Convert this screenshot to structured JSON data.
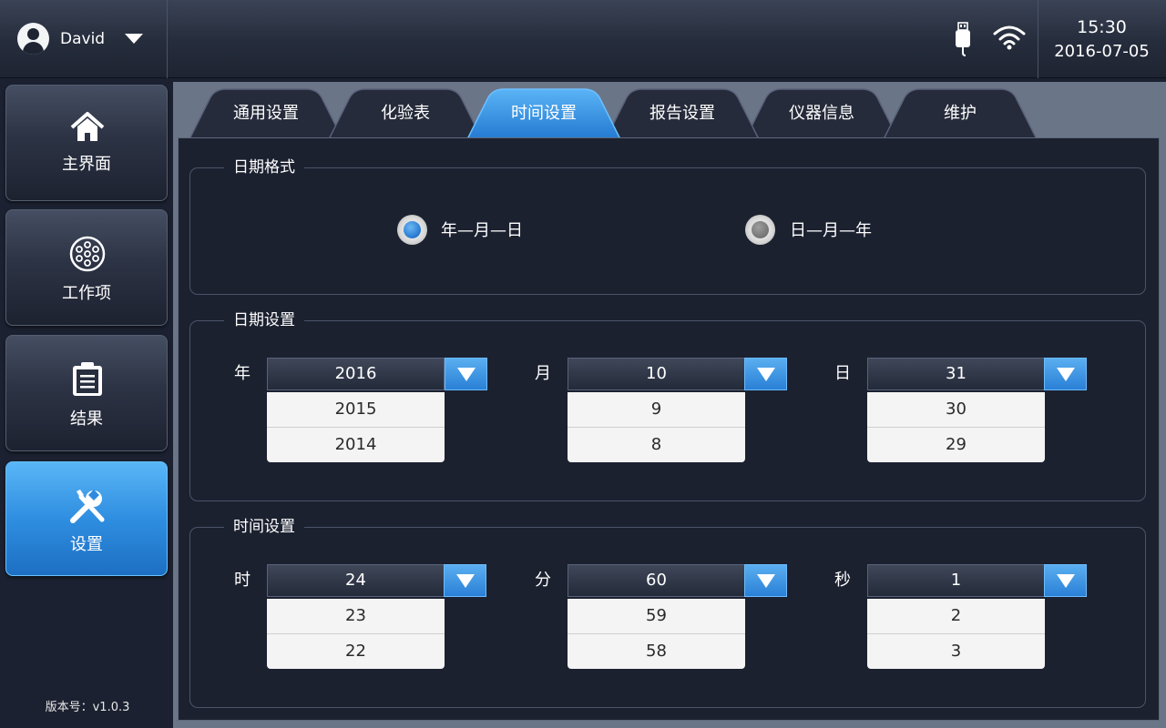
{
  "header": {
    "username": "David",
    "time": "15:30",
    "date": "2016-07-05",
    "icons": [
      "user-avatar-icon",
      "chevron-down-icon",
      "usb-icon",
      "wifi-icon"
    ]
  },
  "sidebar": {
    "items": [
      {
        "label": "主界面",
        "icon": "home-icon"
      },
      {
        "label": "工作项",
        "icon": "sample-tray-icon"
      },
      {
        "label": "结果",
        "icon": "clipboard-icon"
      },
      {
        "label": "设置",
        "icon": "tools-icon",
        "active": true
      }
    ],
    "version": "版本号：v1.0.3"
  },
  "tabs": [
    {
      "label": "通用设置"
    },
    {
      "label": "化验表"
    },
    {
      "label": "时间设置",
      "active": true
    },
    {
      "label": "报告设置"
    },
    {
      "label": "仪器信息"
    },
    {
      "label": "维护"
    }
  ],
  "date_format": {
    "title": "日期格式",
    "options": [
      {
        "label": "年—月—日",
        "selected": true
      },
      {
        "label": "日—月—年",
        "selected": false
      }
    ]
  },
  "date_settings": {
    "title": "日期设置",
    "fields": [
      {
        "label": "年",
        "value": "2016",
        "options": [
          "2015",
          "2014"
        ]
      },
      {
        "label": "月",
        "value": "10",
        "options": [
          "9",
          "8"
        ]
      },
      {
        "label": "日",
        "value": "31",
        "options": [
          "30",
          "29"
        ]
      }
    ]
  },
  "time_settings": {
    "title": "时间设置",
    "fields": [
      {
        "label": "时",
        "value": "24",
        "options": [
          "23",
          "22"
        ]
      },
      {
        "label": "分",
        "value": "60",
        "options": [
          "59",
          "58"
        ]
      },
      {
        "label": "秒",
        "value": "1",
        "options": [
          "2",
          "3"
        ]
      }
    ]
  },
  "colors": {
    "accent": "#2f8ee0",
    "background": "#1b2130"
  }
}
